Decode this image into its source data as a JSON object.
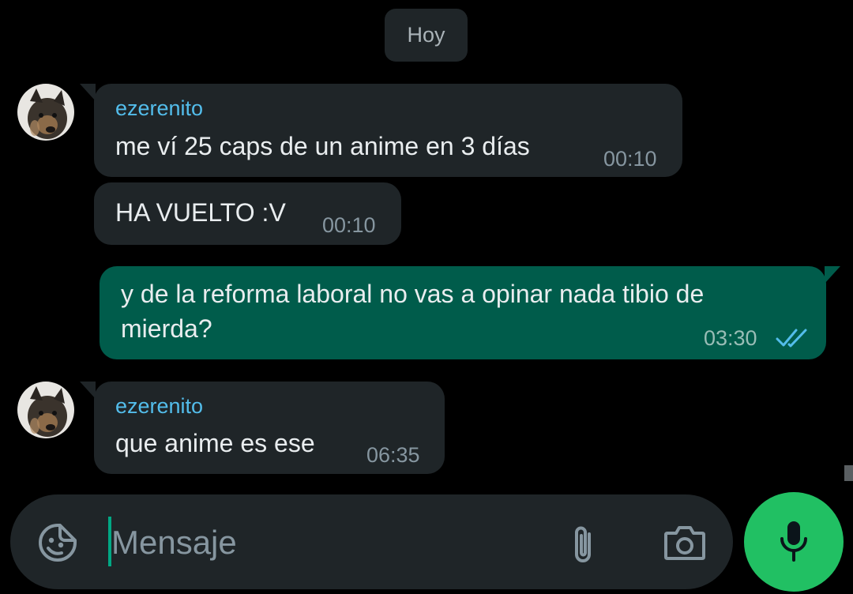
{
  "date_separator": "Hoy",
  "messages": [
    {
      "sender": "ezerenito",
      "text": "me ví 25 caps de un anime en 3 días",
      "time": "00:10"
    },
    {
      "text": "HA VUELTO :V",
      "time": "00:10"
    },
    {
      "text_line1": "y de la reforma laboral no vas a opinar nada tibio de",
      "text_line2": "mierda?",
      "time": "03:30",
      "status": "read"
    },
    {
      "sender": "ezerenito",
      "text": "que anime es ese",
      "time": "06:35"
    }
  ],
  "composer": {
    "placeholder": "Mensaje"
  },
  "icons": {
    "emoji": "sticker-emoji-icon",
    "attach": "paperclip-icon",
    "camera": "camera-icon",
    "mic": "microphone-icon",
    "read": "double-check-icon"
  },
  "colors": {
    "background": "#000000",
    "incoming_bubble": "#1f2528",
    "outgoing_bubble": "#005c4b",
    "sender_name": "#53bdeb",
    "read_ticks": "#53bdeb",
    "mic_button": "#21c063",
    "cursor": "#00a884"
  }
}
